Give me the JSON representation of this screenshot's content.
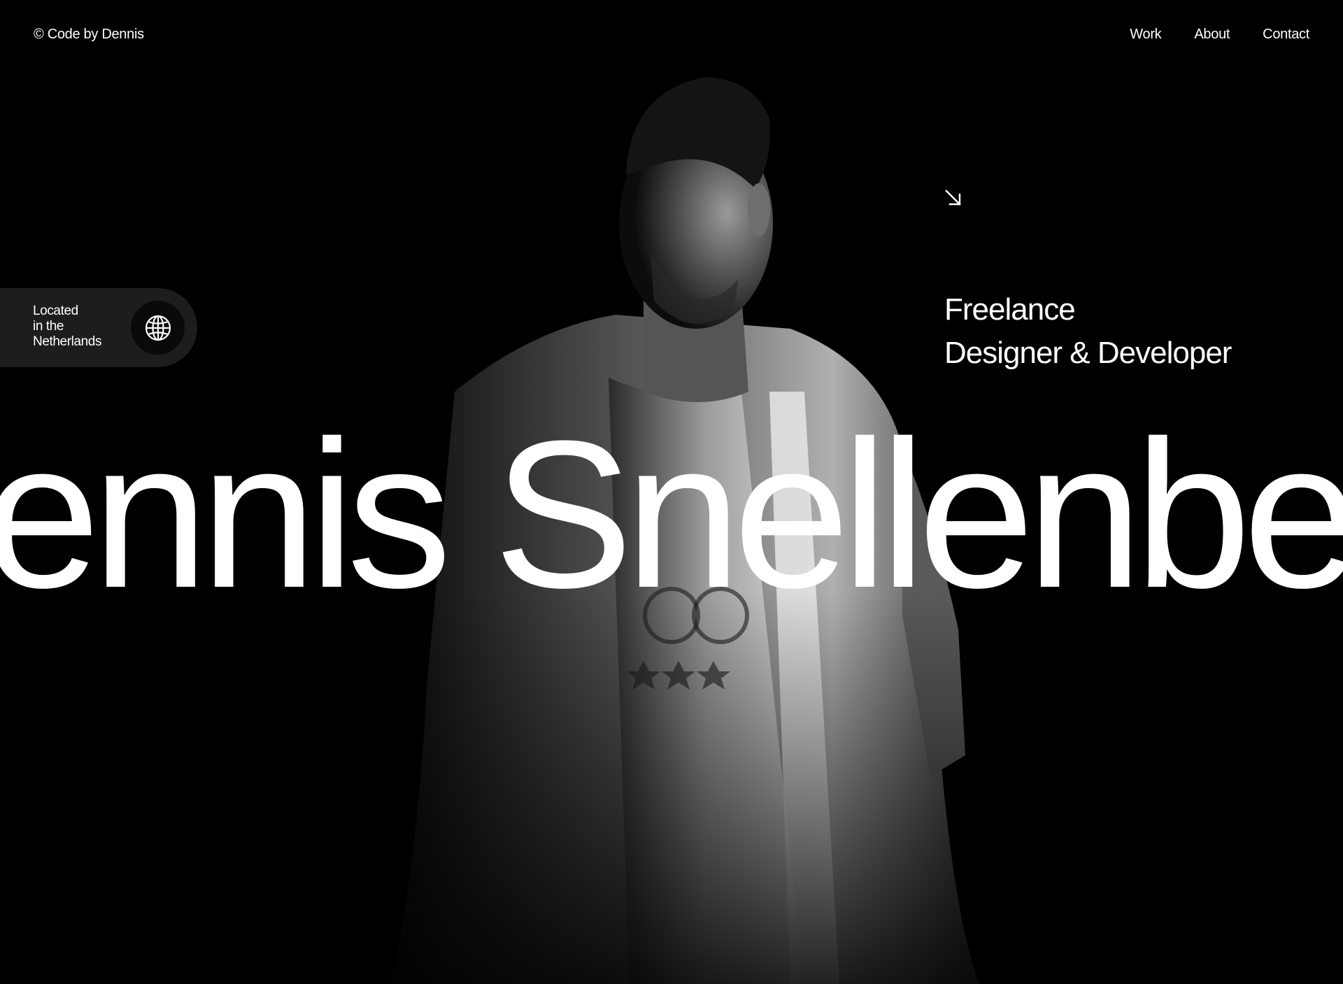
{
  "header": {
    "brand": "© Code by Dennis",
    "nav": [
      "Work",
      "About",
      "Contact"
    ]
  },
  "location": {
    "lines": [
      "Located",
      "in the",
      "Netherlands"
    ],
    "icon": "globe-icon"
  },
  "hero": {
    "arrow_icon": "arrow-down-right-icon",
    "role_lines": [
      "Freelance",
      "Designer & Developer"
    ],
    "name": "Dennis Snellenberg"
  },
  "colors": {
    "background": "#000000",
    "text": "#ffffff",
    "pill": "#1b1d1f"
  }
}
